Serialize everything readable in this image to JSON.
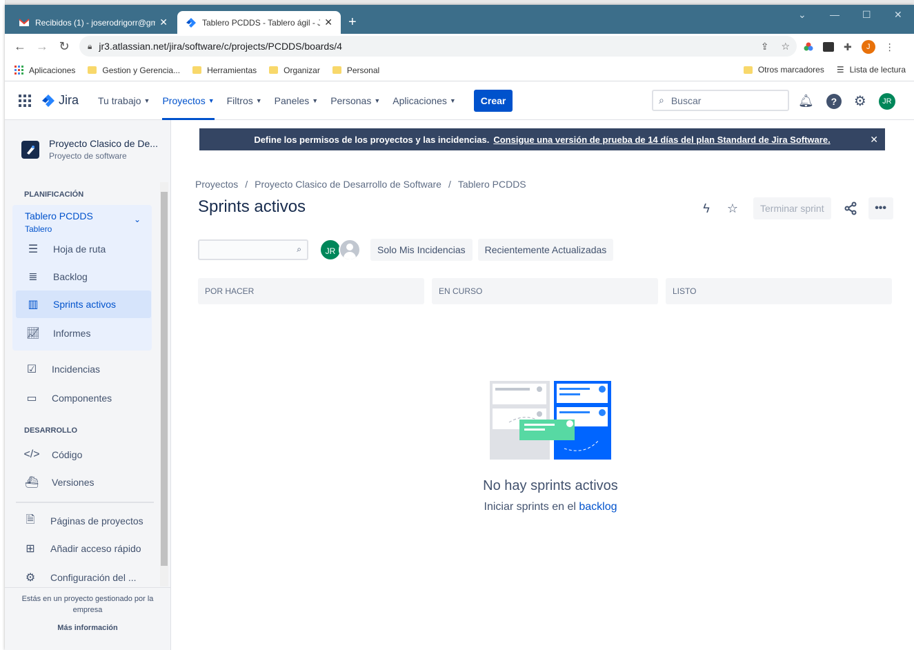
{
  "browser": {
    "tabs": [
      {
        "label": "Recibidos (1) - joserodrigorr@gm"
      },
      {
        "label": "Tablero PCDDS - Tablero ágil - Jira"
      }
    ],
    "url": "jr3.atlassian.net/jira/software/c/projects/PCDDS/boards/4",
    "profile_initial": "J",
    "bookmarks": [
      "Aplicaciones",
      "Gestion y Gerencia...",
      "Herramientas",
      "Organizar",
      "Personal"
    ],
    "bookmarks_right": [
      "Otros marcadores",
      "Lista de lectura"
    ]
  },
  "nav": {
    "product": "Jira",
    "items": [
      "Tu trabajo",
      "Proyectos",
      "Filtros",
      "Paneles",
      "Personas",
      "Aplicaciones"
    ],
    "active": "Proyectos",
    "create_label": "Crear",
    "search_placeholder": "Buscar",
    "avatar_initials": "JR"
  },
  "sidebar": {
    "project_name": "Proyecto Clasico de De...",
    "project_type": "Proyecto de software",
    "section_planning": "PLANIFICACIÓN",
    "board_name": "Tablero PCDDS",
    "board_type": "Tablero",
    "planning_items": [
      "Hoja de ruta",
      "Backlog",
      "Sprints activos",
      "Informes"
    ],
    "selected_item": "Sprints activos",
    "other_items": [
      "Incidencias",
      "Componentes"
    ],
    "section_dev": "DESARROLLO",
    "dev_items": [
      "Código",
      "Versiones"
    ],
    "bottom_items": [
      "Páginas de proyectos",
      "Añadir acceso rápido",
      "Configuración del ..."
    ],
    "footer_note": "Estás en un proyecto gestionado por la empresa",
    "footer_link": "Más información"
  },
  "banner": {
    "text": "Define los permisos de los proyectos y las incidencias.",
    "link": "Consigue una versión de prueba de 14 días del plan Standard de Jira Software."
  },
  "main": {
    "breadcrumb": [
      "Proyectos",
      "Proyecto Clasico de Desarrollo de Software",
      "Tablero PCDDS"
    ],
    "title": "Sprints activos",
    "complete_sprint_label": "Terminar sprint",
    "avatar_initials": "JR",
    "quick_filters": [
      "Solo Mis Incidencias",
      "Recientemente Actualizadas"
    ],
    "columns": [
      "POR HACER",
      "EN CURSO",
      "LISTO"
    ],
    "empty_title": "No hay sprints activos",
    "empty_sub_prefix": "Iniciar sprints en el",
    "empty_sub_link": "backlog"
  },
  "colors": {
    "primary": "#0052cc",
    "tabbar": "#3c6e8a",
    "banner": "#344563",
    "avatar": "#00875a"
  }
}
